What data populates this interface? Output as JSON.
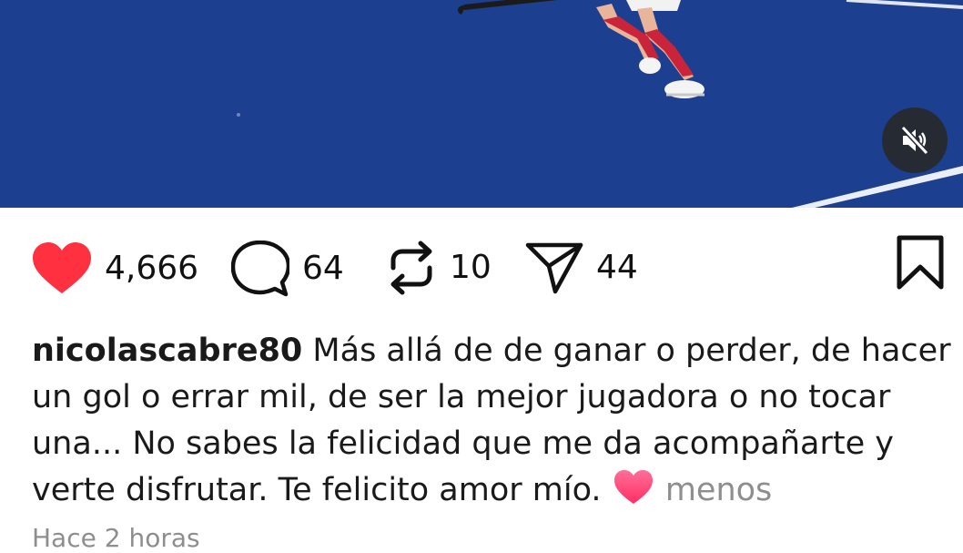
{
  "post": {
    "likes": "4,666",
    "comments": "64",
    "reposts": "10",
    "shares": "44",
    "username": "nicolascabre80",
    "caption": "Más allá de  de ganar o perder, de hacer un gol o errar mil, de ser la mejor jugadora o no tocar una... No sabes la felicidad que me da acompañarte y verte disfrutar. Te felicito amor mío.",
    "less_label": "menos",
    "timestamp": "Hace 2 horas"
  },
  "icons": {
    "like": "heart-icon",
    "comment": "comment-icon",
    "repost": "repost-icon",
    "share": "send-icon",
    "save": "bookmark-icon",
    "mute": "muted-speaker-icon"
  },
  "colors": {
    "like_red": "#ff3040",
    "muted_text": "#8e8e8e",
    "field_blue": "#1d3f8f"
  }
}
